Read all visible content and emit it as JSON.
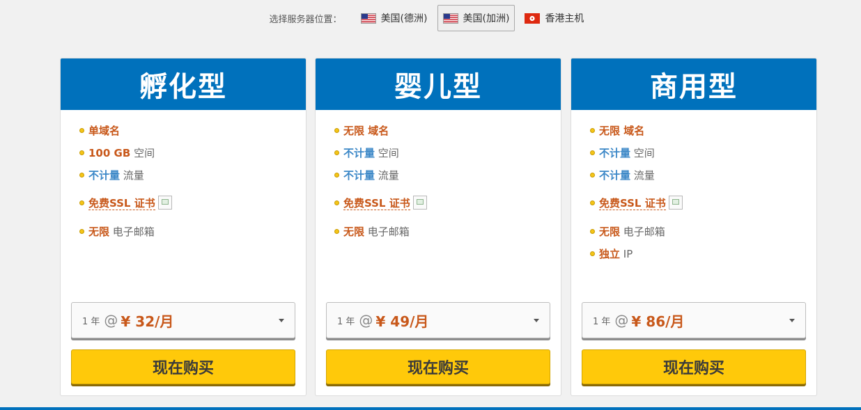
{
  "location": {
    "label": "选择服务器位置：",
    "options": [
      {
        "name": "美国(德洲)",
        "flag": "us-flag-icon",
        "active": false
      },
      {
        "name": "美国(加洲)",
        "flag": "us-flag-icon",
        "active": true
      },
      {
        "name": "香港主机",
        "flag": "hk-flag-icon",
        "active": false
      }
    ]
  },
  "colors": {
    "header": "#0071bc",
    "highlight": "#c8581a",
    "highlight_blue": "#3b87c7",
    "buy_button": "#ffc90a"
  },
  "plans": [
    {
      "title": "孵化型",
      "domain": {
        "value": "单域名",
        "unit": ""
      },
      "space": {
        "value": "100 GB",
        "unit": "空间"
      },
      "traffic": {
        "value": "不计量",
        "unit": "流量"
      },
      "ssl": "免费SSL 证书",
      "email": {
        "value": "无限",
        "unit": "电子邮箱"
      },
      "select": {
        "term": "1 年",
        "at": "@",
        "price": "¥ 32/月"
      },
      "buy": "现在购买"
    },
    {
      "title": "婴儿型",
      "domain": {
        "value": "无限 域名",
        "unit": ""
      },
      "space": {
        "value": "不计量",
        "unit": "空间"
      },
      "traffic": {
        "value": "不计量",
        "unit": "流量"
      },
      "ssl": "免费SSL 证书",
      "email": {
        "value": "无限",
        "unit": "电子邮箱"
      },
      "select": {
        "term": "1 年",
        "at": "@",
        "price": "¥ 49/月"
      },
      "buy": "现在购买"
    },
    {
      "title": "商用型",
      "domain": {
        "value": "无限 域名",
        "unit": ""
      },
      "space": {
        "value": "不计量",
        "unit": "空间"
      },
      "traffic": {
        "value": "不计量",
        "unit": "流量"
      },
      "ssl": "免费SSL 证书",
      "email": {
        "value": "无限",
        "unit": "电子邮箱"
      },
      "ip": {
        "value": "独立",
        "unit": "IP"
      },
      "select": {
        "term": "1 年",
        "at": "@",
        "price": "¥ 86/月"
      },
      "buy": "现在购买"
    }
  ]
}
